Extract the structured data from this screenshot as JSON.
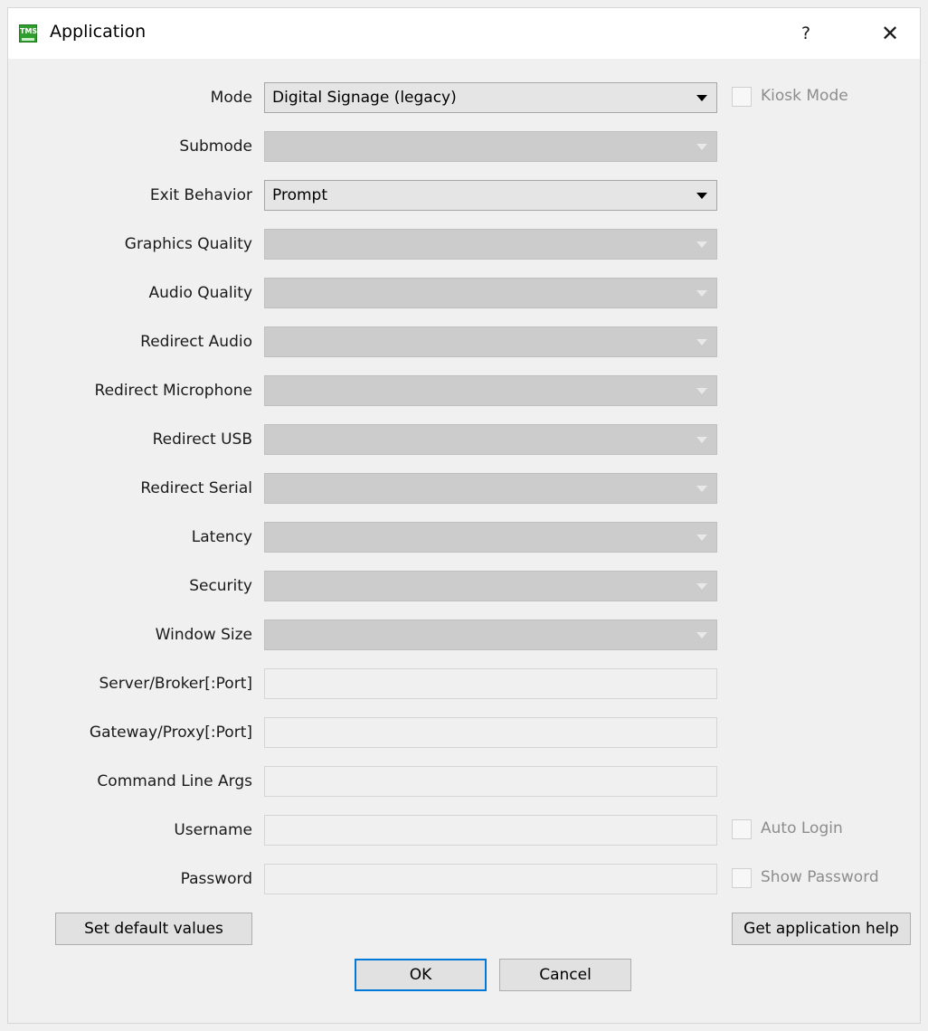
{
  "window": {
    "title": "Application",
    "icon_text": "TMS",
    "help_label": "?",
    "close_label": "✕"
  },
  "form": {
    "mode": {
      "label": "Mode",
      "value": "Digital Signage (legacy)"
    },
    "kiosk_mode": {
      "label": "Kiosk Mode",
      "checked": false
    },
    "submode": {
      "label": "Submode",
      "value": ""
    },
    "exit_behavior": {
      "label": "Exit Behavior",
      "value": "Prompt"
    },
    "graphics_quality": {
      "label": "Graphics Quality",
      "value": ""
    },
    "audio_quality": {
      "label": "Audio Quality",
      "value": ""
    },
    "redirect_audio": {
      "label": "Redirect Audio",
      "value": ""
    },
    "redirect_microphone": {
      "label": "Redirect Microphone",
      "value": ""
    },
    "redirect_usb": {
      "label": "Redirect USB",
      "value": ""
    },
    "redirect_serial": {
      "label": "Redirect Serial",
      "value": ""
    },
    "latency": {
      "label": "Latency",
      "value": ""
    },
    "security": {
      "label": "Security",
      "value": ""
    },
    "window_size": {
      "label": "Window Size",
      "value": ""
    },
    "server_broker": {
      "label": "Server/Broker[:Port]",
      "value": ""
    },
    "gateway_proxy": {
      "label": "Gateway/Proxy[:Port]",
      "value": ""
    },
    "command_line_args": {
      "label": "Command Line Args",
      "value": ""
    },
    "username": {
      "label": "Username",
      "value": ""
    },
    "auto_login": {
      "label": "Auto Login",
      "checked": false
    },
    "password": {
      "label": "Password",
      "value": ""
    },
    "show_password": {
      "label": "Show Password",
      "checked": false
    }
  },
  "buttons": {
    "set_defaults": "Set default values",
    "app_help": "Get application help",
    "ok": "OK",
    "cancel": "Cancel"
  },
  "colors": {
    "icon_green": "#2f9e2f",
    "default_button_border": "#0078d7",
    "disabled_combo": "#cccccc"
  }
}
